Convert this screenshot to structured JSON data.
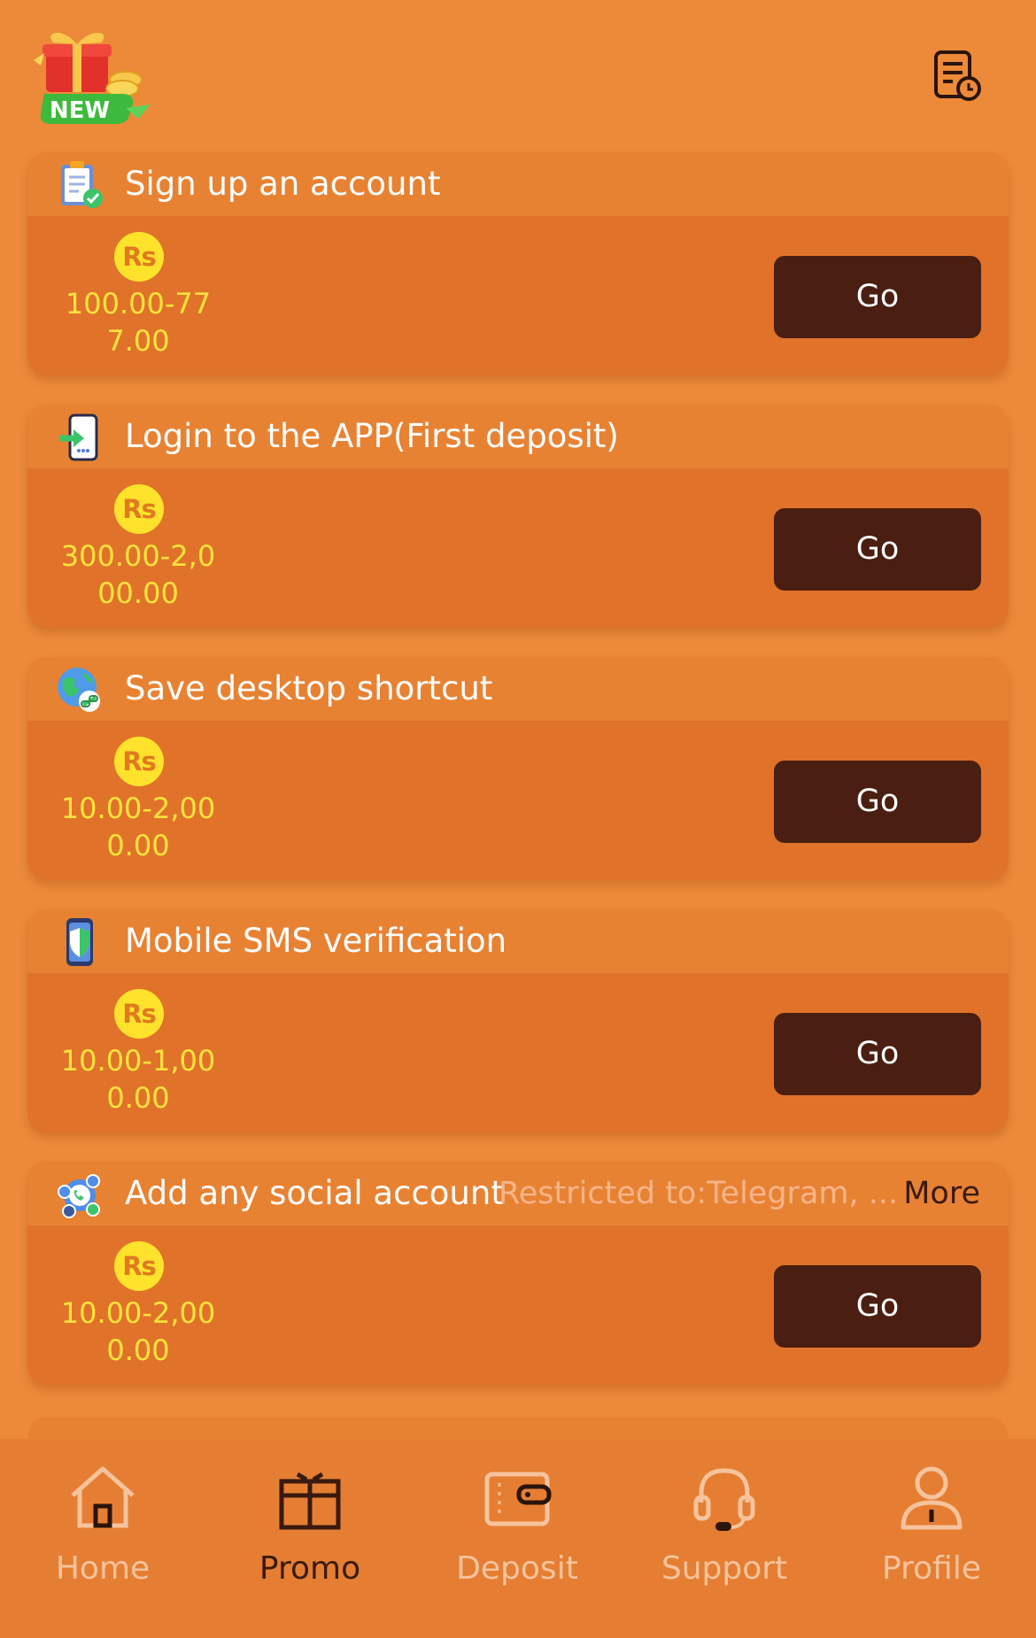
{
  "header": {
    "badge_text": "NEW",
    "history_icon": "history-icon"
  },
  "tasks": [
    {
      "title": "Sign up an account",
      "currency": "Rs",
      "amount_line1": "100.00-77",
      "amount_line2": "7.00",
      "button": "Go",
      "icon": "clipboard-check-icon"
    },
    {
      "title": "Login to the APP(First deposit)",
      "currency": "Rs",
      "amount_line1": "300.00-2,0",
      "amount_line2": "00.00",
      "button": "Go",
      "icon": "phone-login-icon"
    },
    {
      "title": "Save desktop shortcut",
      "currency": "Rs",
      "amount_line1": "10.00-2,00",
      "amount_line2": "0.00",
      "button": "Go",
      "icon": "globe-link-icon"
    },
    {
      "title": "Mobile SMS verification",
      "currency": "Rs",
      "amount_line1": "10.00-1,00",
      "amount_line2": "0.00",
      "button": "Go",
      "icon": "phone-shield-icon"
    },
    {
      "title": "Add any social account",
      "note": "Restricted to:Telegram, ...",
      "more": "More",
      "currency": "Rs",
      "amount_line1": "10.00-2,00",
      "amount_line2": "0.00",
      "button": "Go",
      "icon": "social-apps-icon"
    }
  ],
  "nav": [
    {
      "label": "Home",
      "icon": "home-icon"
    },
    {
      "label": "Promo",
      "icon": "gift-icon",
      "active": true
    },
    {
      "label": "Deposit",
      "icon": "wallet-icon"
    },
    {
      "label": "Support",
      "icon": "headset-icon"
    },
    {
      "label": "Profile",
      "icon": "user-icon"
    }
  ],
  "colors": {
    "background": "#EC8A3A",
    "card": "#E07329",
    "card_header": "#E88233",
    "button": "#4A1E10",
    "amount": "#FFE33D",
    "coin": "#FFE22C",
    "nav_inactive": "#F6C39C",
    "nav_active": "#3A1A0E"
  }
}
